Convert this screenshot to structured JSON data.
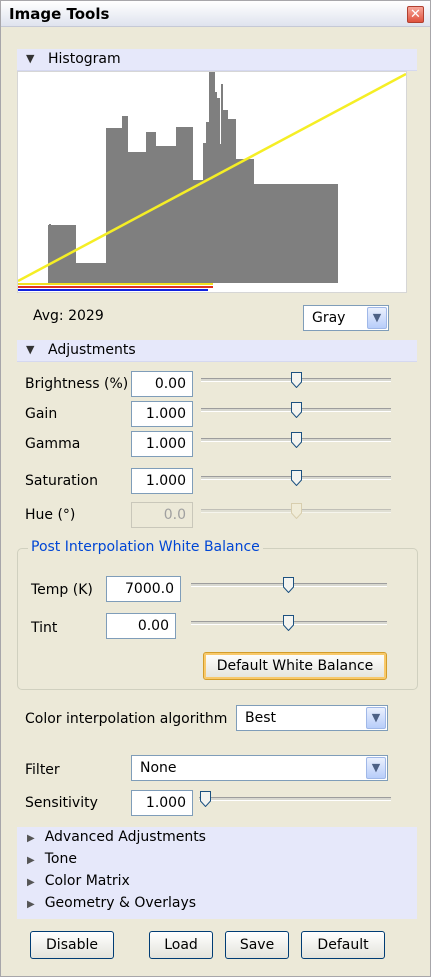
{
  "window": {
    "title": "Image Tools",
    "close_glyph": "✕"
  },
  "histogram": {
    "section_label": "Histogram",
    "avg_text": "Avg: 2029",
    "channel_select": "Gray",
    "colors": {
      "bars": "#7f7f7f",
      "curve": "#f5ee25",
      "red": "#e03020",
      "yellow": "#f0e020",
      "blue": "#1020e0"
    }
  },
  "adjustments": {
    "section_label": "Adjustments",
    "rows": [
      {
        "label": "Brightness (%)",
        "value": "0.00",
        "slider": 0.5,
        "enabled": true
      },
      {
        "label": "Gain",
        "value": "1.000",
        "slider": 0.5,
        "enabled": true
      },
      {
        "label": "Gamma",
        "value": "1.000",
        "slider": 0.5,
        "enabled": true
      },
      {
        "label": "Saturation",
        "value": "1.000",
        "slider": 0.5,
        "enabled": true
      },
      {
        "label": "Hue (°)",
        "value": "0.0",
        "slider": 0.5,
        "enabled": false
      }
    ]
  },
  "white_balance": {
    "title": "Post Interpolation White Balance",
    "rows": [
      {
        "label": "Temp (K)",
        "value": "7000.0",
        "slider": 0.5
      },
      {
        "label": "Tint",
        "value": "0.00",
        "slider": 0.5
      }
    ],
    "default_button": "Default White Balance"
  },
  "color_interp": {
    "label": "Color interpolation algorithm",
    "value": "Best"
  },
  "filter": {
    "label": "Filter",
    "value": "None"
  },
  "sensitivity": {
    "label": "Sensitivity",
    "value": "1.000",
    "slider": 0.0
  },
  "collapsed_sections": [
    "Advanced Adjustments",
    "Tone",
    "Color Matrix",
    "Geometry & Overlays"
  ],
  "buttons": {
    "disable": "Disable",
    "load": "Load",
    "save": "Save",
    "default": "Default"
  }
}
